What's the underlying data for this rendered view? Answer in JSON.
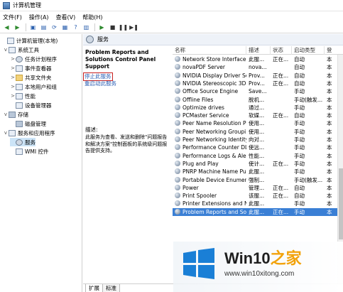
{
  "window": {
    "title": "计算机管理"
  },
  "menu": [
    "文件(F)",
    "操作(A)",
    "查看(V)",
    "帮助(H)"
  ],
  "tree": {
    "items": [
      {
        "label": "计算机管理(本地)",
        "toggle": "",
        "icon": "computer"
      },
      {
        "label": "系统工具",
        "toggle": "v",
        "icon": "tools"
      },
      {
        "label": "任务计划程序",
        "toggle": ">",
        "icon": "clock"
      },
      {
        "label": "事件查看器",
        "toggle": ">",
        "icon": "event"
      },
      {
        "label": "共享文件夹",
        "toggle": ">",
        "icon": "folder"
      },
      {
        "label": "本地用户和组",
        "toggle": ">",
        "icon": "users"
      },
      {
        "label": "性能",
        "toggle": ">",
        "icon": "perf"
      },
      {
        "label": "设备管理器",
        "toggle": "",
        "icon": "device"
      },
      {
        "label": "存储",
        "toggle": "v",
        "icon": "storage"
      },
      {
        "label": "磁盘管理",
        "toggle": "",
        "icon": "disk"
      },
      {
        "label": "服务和应用程序",
        "toggle": "v",
        "icon": "apps"
      },
      {
        "label": "服务",
        "toggle": "",
        "icon": "gear"
      },
      {
        "label": "WMI 控件",
        "toggle": "",
        "icon": "wmi"
      }
    ]
  },
  "content": {
    "title": "服务",
    "service_name": "Problem Reports and Solutions Control Panel Support",
    "stop_link": "停止此服务",
    "restart_link": "重启动此服务",
    "desc_label": "描述:",
    "desc_text": "此服务为查看、发送和删除\"问题报告和解决方案\"控制面板的系统级问题报告提供支持。"
  },
  "columns": [
    "名称",
    "描述",
    "状态",
    "启动类型",
    "登"
  ],
  "services": [
    {
      "name": "Network Store Interface ...",
      "desc": "此服...",
      "status": "正在...",
      "startup": "自动",
      "logon": "本"
    },
    {
      "name": "novaPDF Server",
      "desc": "nova...",
      "status": "",
      "startup": "自动",
      "logon": "本"
    },
    {
      "name": "NVIDIA Display Driver Se...",
      "desc": "Prov...",
      "status": "正在...",
      "startup": "自动",
      "logon": "本"
    },
    {
      "name": "NVIDIA Stereoscopic 3D ...",
      "desc": "Prov...",
      "status": "正在...",
      "startup": "自动",
      "logon": "本"
    },
    {
      "name": "Office  Source Engine",
      "desc": "Save...",
      "status": "",
      "startup": "手动",
      "logon": "本"
    },
    {
      "name": "Offline Files",
      "desc": "脱机...",
      "status": "",
      "startup": "手动(触发...",
      "logon": "本"
    },
    {
      "name": "Optimize drives",
      "desc": "通过...",
      "status": "",
      "startup": "手动",
      "logon": "本"
    },
    {
      "name": "PCMaster Service",
      "desc": "软媒...",
      "status": "正在...",
      "startup": "自动",
      "logon": "本"
    },
    {
      "name": "Peer Name Resolution Pr...",
      "desc": "使用...",
      "status": "",
      "startup": "手动",
      "logon": "本"
    },
    {
      "name": "Peer Networking Groupi...",
      "desc": "使用...",
      "status": "",
      "startup": "手动",
      "logon": "本"
    },
    {
      "name": "Peer Networking Identity...",
      "desc": "向对...",
      "status": "",
      "startup": "手动",
      "logon": "本"
    },
    {
      "name": "Performance Counter DL...",
      "desc": "使远...",
      "status": "",
      "startup": "手动",
      "logon": "本"
    },
    {
      "name": "Performance Logs & Aler...",
      "desc": "性能...",
      "status": "",
      "startup": "手动",
      "logon": "本"
    },
    {
      "name": "Plug and Play",
      "desc": "使计...",
      "status": "正在...",
      "startup": "手动",
      "logon": "本"
    },
    {
      "name": "PNRP Machine Name Pu...",
      "desc": "此服...",
      "status": "",
      "startup": "手动",
      "logon": "本"
    },
    {
      "name": "Portable Device Enumera...",
      "desc": "强制...",
      "status": "",
      "startup": "手动(触发...",
      "logon": "本"
    },
    {
      "name": "Power",
      "desc": "管理...",
      "status": "正在...",
      "startup": "自动",
      "logon": "本"
    },
    {
      "name": "Print Spooler",
      "desc": "该服...",
      "status": "正在...",
      "startup": "自动",
      "logon": "本"
    },
    {
      "name": "Printer Extensions and N...",
      "desc": "此服...",
      "status": "",
      "startup": "手动",
      "logon": "本"
    },
    {
      "name": "Problem Reports and Sol...",
      "desc": "此服...",
      "status": "正在...",
      "startup": "手动",
      "logon": "本",
      "selected": true
    }
  ],
  "tabs": [
    "扩展",
    "标准"
  ],
  "watermark": {
    "brand_prefix": "Win10",
    "brand_suffix": "之家",
    "url": "www.win10xitong.com",
    "accent_color": "#f2a20a",
    "logo_color": "#1a7fd6"
  }
}
